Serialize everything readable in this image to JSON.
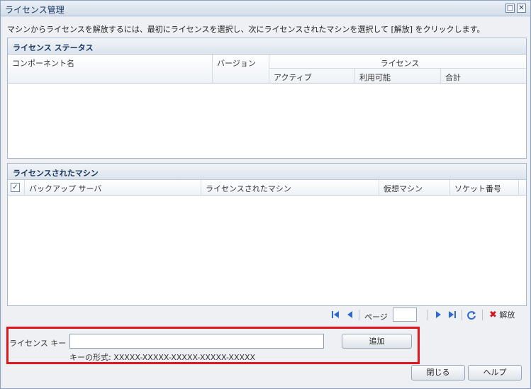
{
  "window": {
    "title": "ライセンス管理",
    "restore_glyph": "□",
    "close_glyph": "✕"
  },
  "instruction": "マシンからライセンスを解放するには、最初にライセンスを選択し、次にライセンスされたマシンを選択して [解放] をクリックします。",
  "license_status": {
    "header": "ライセンス ステータス",
    "columns": {
      "component": "コンポーネント名",
      "version": "バージョン",
      "license": "ライセンス",
      "active": "アクティブ",
      "available": "利用可能",
      "total": "合計"
    }
  },
  "licensed_machines": {
    "header": "ライセンスされたマシン",
    "columns": {
      "backup_server": "バックアップ サーバ",
      "licensed_machine": "ライセンスされたマシン",
      "virtual_machine": "仮想マシン",
      "socket_count": "ソケット番号"
    },
    "select_all_checked": true
  },
  "pager": {
    "first_icon": "first-page-icon",
    "prev_icon": "prev-page-icon",
    "page_label": "ページ",
    "page_value": "",
    "next_icon": "next-page-icon",
    "last_icon": "last-page-icon",
    "refresh_icon": "refresh-icon",
    "release_label": "解放"
  },
  "license_key": {
    "label": "ライセンス キー",
    "value": "",
    "format_hint": "キーの形式: XXXXX-XXXXX-XXXXX-XXXXX-XXXXX",
    "add_label": "追加"
  },
  "footer": {
    "close_label": "閉じる",
    "help_label": "ヘルプ"
  },
  "colors": {
    "highlight": "#e0161d",
    "accent": "#2d6ad0"
  }
}
